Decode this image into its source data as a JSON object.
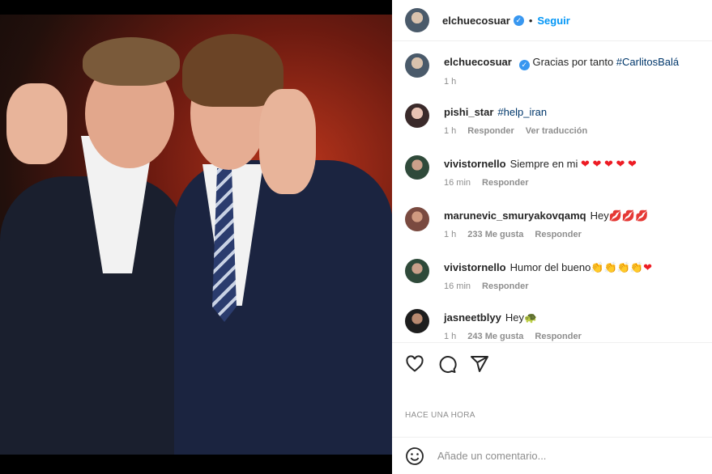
{
  "post": {
    "username": "elchuecosuar",
    "follow_label": "Seguir",
    "dot": "•",
    "verified_mark": "✓"
  },
  "caption": {
    "username": "elchuecosuar",
    "text": "Gracias por tanto",
    "hashtag": "#CarlitosBalá",
    "time": "1 h"
  },
  "comments": [
    {
      "username": "pishi_star",
      "text": "",
      "hashtag": "#help_iran",
      "time": "1 h",
      "reply": "Responder",
      "extra": "Ver traducción"
    },
    {
      "username": "vivistornello",
      "text": "Siempre en mi",
      "emoji": "❤ ❤ ❤ ❤ ❤",
      "time": "16 min",
      "reply": "Responder"
    },
    {
      "username": "marunevic_smuryakovqamq",
      "text": "Hey",
      "emoji": "💋💋💋",
      "time": "1 h",
      "likes": "233 Me gusta",
      "reply": "Responder"
    },
    {
      "username": "vivistornello",
      "text": "Humor del bueno",
      "emoji": "👏👏👏👏",
      "emoji2": "❤",
      "time": "16 min",
      "reply": "Responder"
    },
    {
      "username": "jasneetblyy",
      "text": "Hey",
      "emoji": "🐢",
      "time": "1 h",
      "likes": "243 Me gusta",
      "reply": "Responder"
    }
  ],
  "timestamp": "HACE UNA HORA",
  "comment_input": {
    "placeholder": "Añade un comentario..."
  },
  "colors": {
    "accent": "#0095f6",
    "verified": "#3897f0",
    "heart": "#ed1c24"
  },
  "icons": [
    "like-icon",
    "comment-icon",
    "share-icon",
    "emoji-icon"
  ]
}
